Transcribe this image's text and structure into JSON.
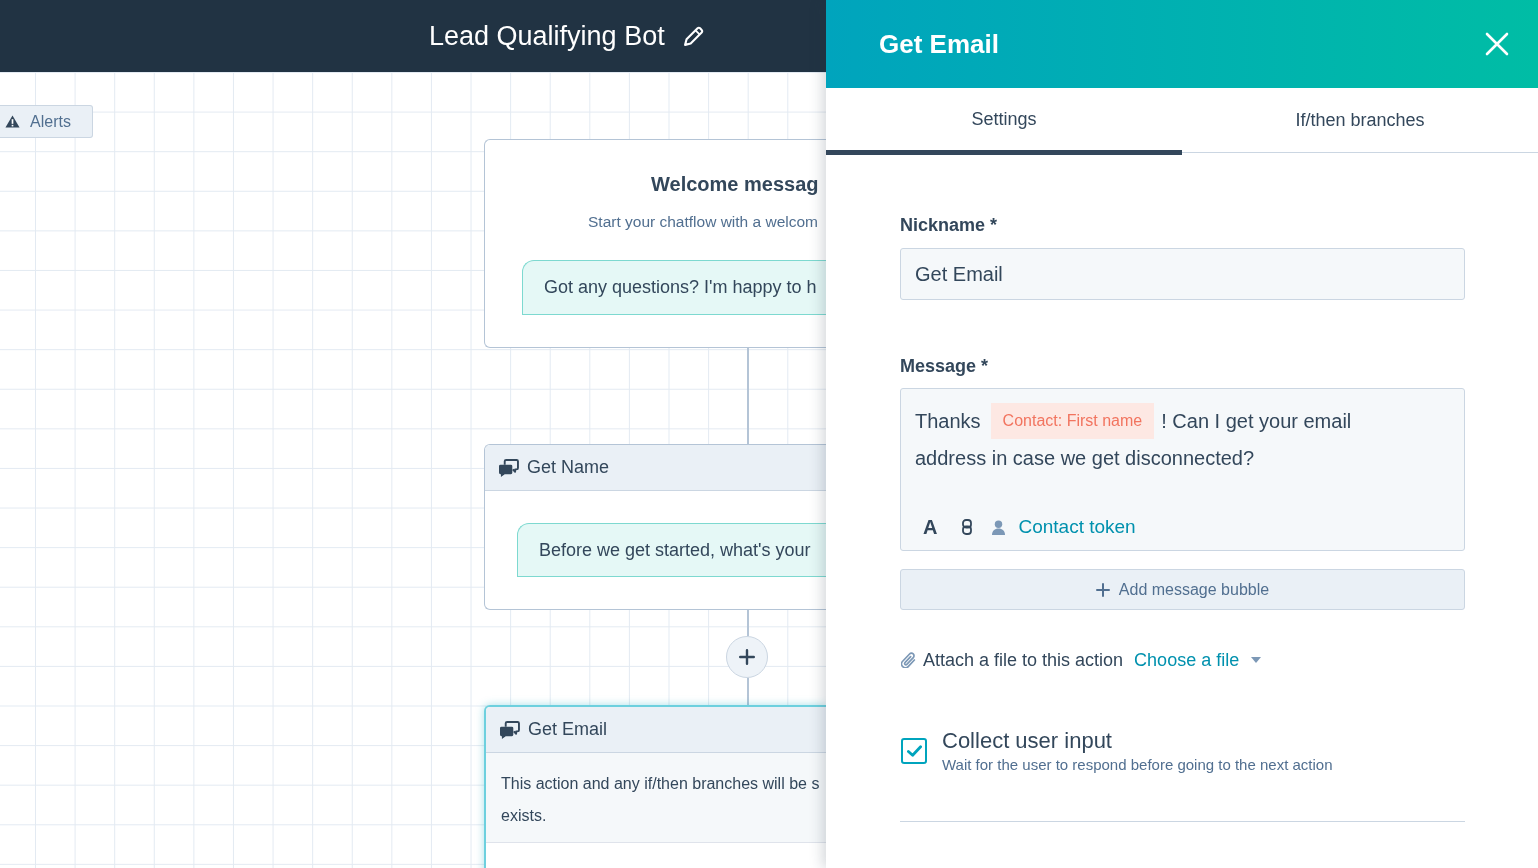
{
  "header": {
    "title": "Lead Qualifying Bot"
  },
  "canvas": {
    "alerts_button": "Alerts",
    "nodes": [
      {
        "kind": "welcome",
        "title": "Welcome messag",
        "subtitle": "Start your chatflow with a welcom",
        "bubble": "Got any questions? I'm happy to h",
        "selected": false
      },
      {
        "kind": "action",
        "title": "Get Name",
        "bubble": "Before we get started, what's your",
        "selected": false
      },
      {
        "kind": "action",
        "title": "Get Email",
        "notice_lines": [
          "This action and any if/then branches will be s",
          "exists."
        ],
        "selected": true
      }
    ]
  },
  "panel": {
    "title": "Get Email",
    "tabs": [
      {
        "label": "Settings",
        "selected": true
      },
      {
        "label": "If/then branches",
        "selected": false
      }
    ],
    "nickname": {
      "label": "Nickname *",
      "value": "Get Email"
    },
    "message": {
      "label": "Message *",
      "parts": [
        {
          "kind": "text",
          "text": "Thanks"
        },
        {
          "kind": "token",
          "text": "Contact: First name"
        },
        {
          "kind": "text",
          "text": "! Can I get your email address in case we get disconnected?"
        }
      ],
      "format_button": "A",
      "token_link": "Contact token"
    },
    "add_bubble_button": "Add message bubble",
    "attachment": {
      "label": "Attach a file to this action",
      "link": "Choose a file"
    },
    "collect_input": {
      "label": "Collect user input",
      "description": "Wait for the user to respond before going to the next action",
      "checked": true
    }
  }
}
